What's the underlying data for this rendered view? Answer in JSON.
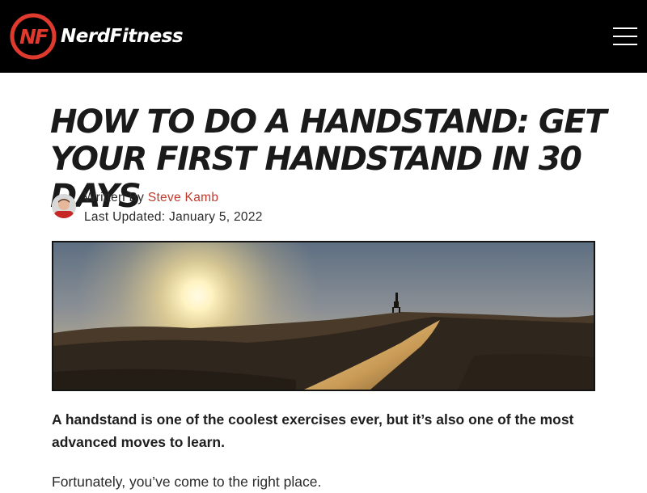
{
  "header": {
    "logo_text": "NerdFitness",
    "logo_mark_text": "NF",
    "menu_icon": "hamburger-menu-icon",
    "colors": {
      "background": "#000000",
      "accent": "#e03a2f",
      "text": "#ffffff"
    }
  },
  "article": {
    "title": "How to do a Handstand: Get Your First Handstand in 30 Days",
    "byline": {
      "written_by_label": "Written By",
      "author": "Steve Kamb",
      "updated_label": "Last Updated:",
      "updated_date": "January 5, 2022"
    },
    "lead": "A handstand is one of the coolest exercises ever, but it’s also one of the most advanced moves to learn.",
    "paragraph": "Fortunately, you’ve come to the right place."
  },
  "colors": {
    "author_link": "#c0392b",
    "title": "#1a1a1a",
    "body_text": "#2a2a2a"
  }
}
